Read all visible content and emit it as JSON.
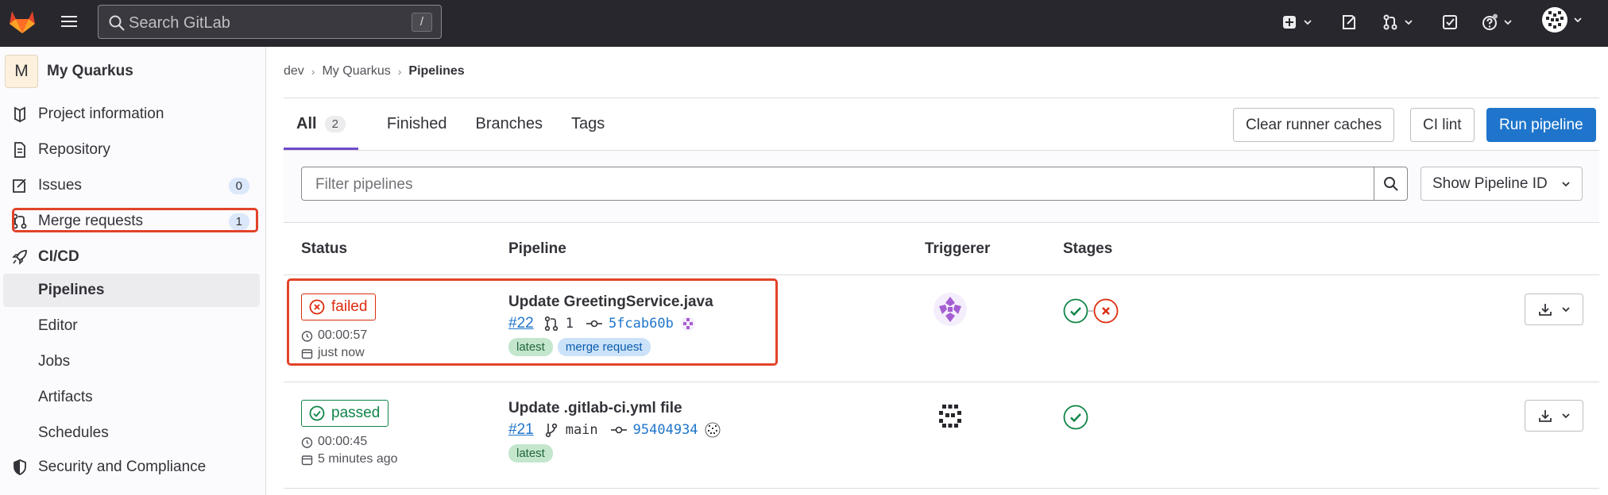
{
  "search": {
    "placeholder": "Search GitLab",
    "shortcut": "/"
  },
  "sidebar": {
    "project_initial": "M",
    "project_name": "My Quarkus",
    "items": [
      {
        "label": "Project information",
        "icon": "project-icon"
      },
      {
        "label": "Repository",
        "icon": "document-icon"
      },
      {
        "label": "Issues",
        "icon": "issues-icon",
        "badge": "0"
      },
      {
        "label": "Merge requests",
        "icon": "merge-request-icon",
        "badge": "1"
      },
      {
        "label": "CI/CD",
        "icon": "rocket-icon"
      }
    ],
    "cicd_sub": [
      "Pipelines",
      "Editor",
      "Jobs",
      "Artifacts",
      "Schedules"
    ],
    "security": "Security and Compliance"
  },
  "breadcrumb": {
    "group": "dev",
    "project": "My Quarkus",
    "current": "Pipelines"
  },
  "tabs": {
    "all": "All",
    "all_count": "2",
    "finished": "Finished",
    "branches": "Branches",
    "tags": "Tags"
  },
  "buttons": {
    "clear_cache": "Clear runner caches",
    "ci_lint": "CI lint",
    "run_pipeline": "Run pipeline"
  },
  "filter": {
    "placeholder": "Filter pipelines",
    "show_id": "Show Pipeline ID"
  },
  "table": {
    "headers": {
      "status": "Status",
      "pipeline": "Pipeline",
      "triggerer": "Triggerer",
      "stages": "Stages"
    },
    "rows": [
      {
        "status": "failed",
        "duration": "00:00:57",
        "finished": "just now",
        "title": "Update GreetingService.java",
        "id": "#22",
        "ref_icon": "merge-request-icon",
        "ref": "1",
        "sha": "5fcab60b",
        "tags": [
          "latest",
          "merge request"
        ],
        "stages": [
          "success",
          "failed"
        ]
      },
      {
        "status": "passed",
        "duration": "00:00:45",
        "finished": "5 minutes ago",
        "title": "Update .gitlab-ci.yml file",
        "id": "#21",
        "ref_icon": "branch-icon",
        "ref": "main",
        "sha": "95404934",
        "tags": [
          "latest"
        ],
        "stages": [
          "success"
        ]
      }
    ]
  },
  "colors": {
    "failed": "#dd2b0e",
    "passed": "#108548",
    "primary": "#1f75cb",
    "highlight": "#e24329"
  }
}
